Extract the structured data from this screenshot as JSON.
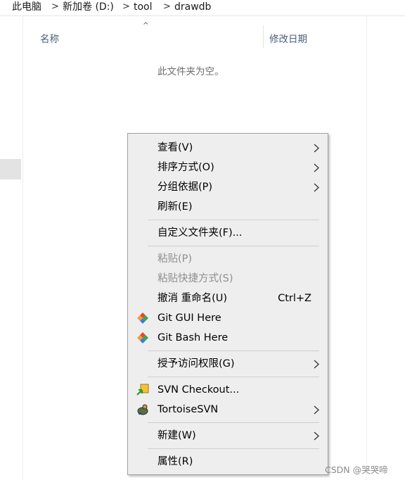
{
  "breadcrumb": {
    "items": [
      "此电脑",
      "新加卷 (D:)",
      "tool",
      "drawdb"
    ],
    "separator": ">"
  },
  "columns": {
    "name": "名称",
    "date_modified": "修改日期"
  },
  "empty_message": "此文件夹为空。",
  "context_menu": {
    "view": {
      "label": "查看(V)"
    },
    "sort_by": {
      "label": "排序方式(O)"
    },
    "group_by": {
      "label": "分组依据(P)"
    },
    "refresh": {
      "label": "刷新(E)"
    },
    "customize_folder": {
      "label": "自定义文件夹(F)..."
    },
    "paste": {
      "label": "粘贴(P)"
    },
    "paste_shortcut": {
      "label": "粘贴快捷方式(S)"
    },
    "undo_rename": {
      "label": "撤消 重命名(U)",
      "shortcut": "Ctrl+Z"
    },
    "git_gui": {
      "label": "Git GUI Here",
      "icon": "git-gui-icon"
    },
    "git_bash": {
      "label": "Git Bash Here",
      "icon": "git-bash-icon"
    },
    "give_access": {
      "label": "授予访问权限(G)"
    },
    "svn_checkout": {
      "label": "SVN Checkout...",
      "icon": "svn-checkout-icon"
    },
    "tortoise_svn": {
      "label": "TortoiseSVN",
      "icon": "tortoisesvn-icon"
    },
    "new": {
      "label": "新建(W)"
    },
    "properties": {
      "label": "属性(R)"
    }
  },
  "watermark": "CSDN @哭哭啼",
  "colors": {
    "menu_bg": "#eeeeee",
    "menu_border": "#a0a0a0",
    "disabled_text": "#8f8f8f",
    "column_header_text": "#4c607a"
  }
}
